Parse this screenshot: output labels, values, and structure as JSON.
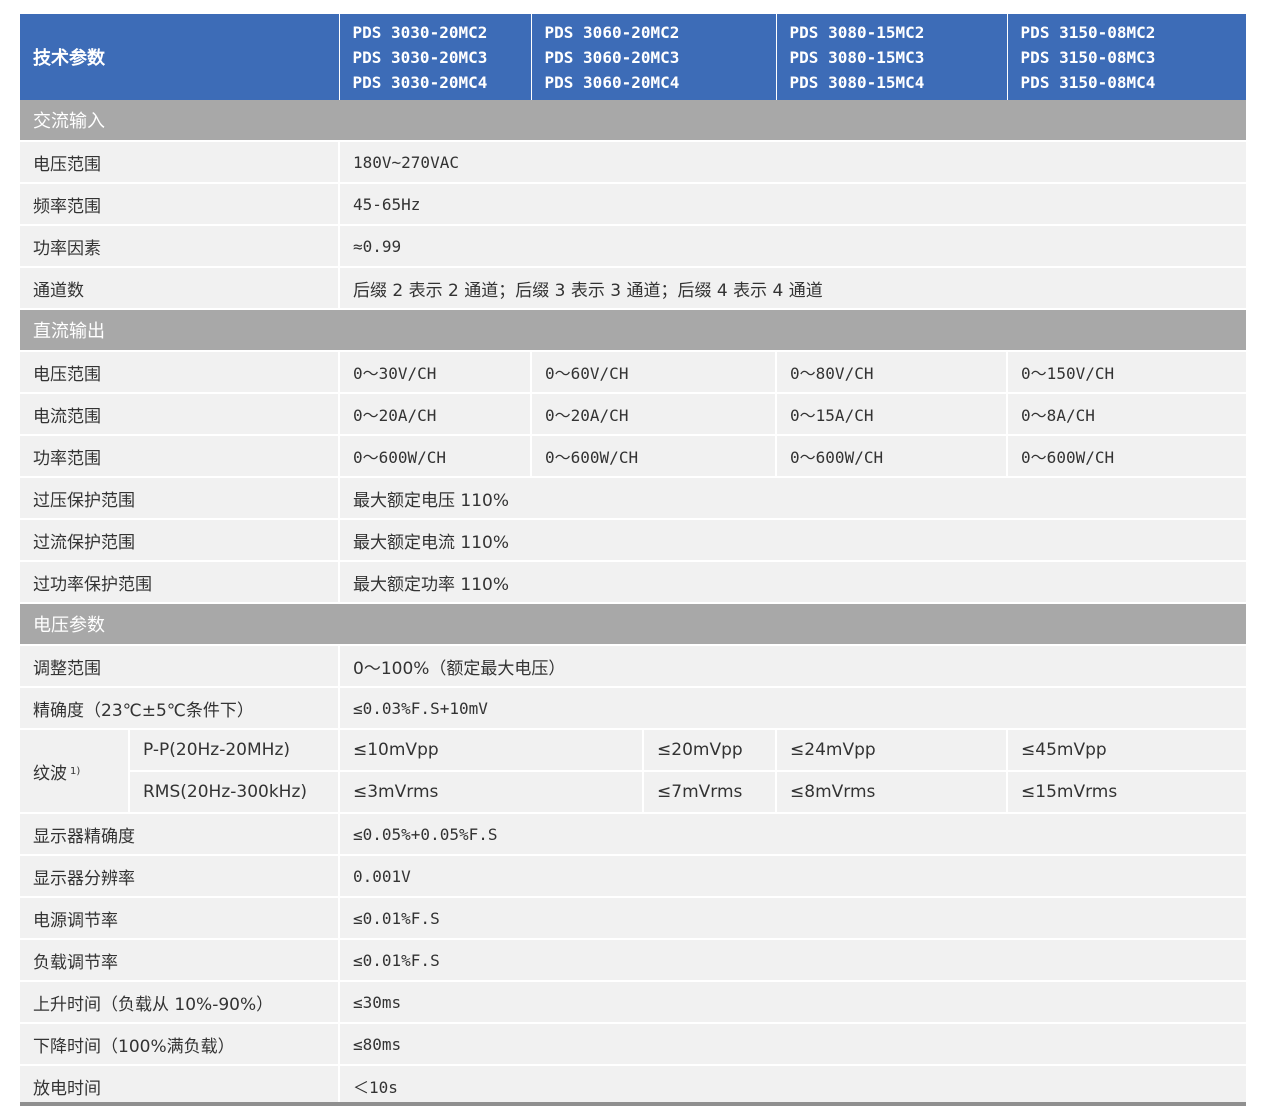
{
  "header": {
    "title": "技术参数",
    "model_groups": [
      [
        "PDS 3030-20MC2",
        "PDS 3030-20MC3",
        "PDS 3030-20MC4"
      ],
      [
        "PDS 3060-20MC2",
        "PDS 3060-20MC3",
        "PDS 3060-20MC4"
      ],
      [
        "PDS 3080-15MC2",
        "PDS 3080-15MC3",
        "PDS 3080-15MC4"
      ],
      [
        "PDS 3150-08MC2",
        "PDS 3150-08MC3",
        "PDS 3150-08MC4"
      ]
    ]
  },
  "ac_input": {
    "title": "交流输入",
    "rows": [
      {
        "label": "电压范围",
        "value": "180V~270VAC"
      },
      {
        "label": "频率范围",
        "value": "45-65Hz"
      },
      {
        "label": "功率因素",
        "value": "≈0.99"
      },
      {
        "label": "通道数",
        "value": "后缀 2 表示 2 通道；后缀 3 表示 3 通道；后缀 4 表示 4 通道"
      }
    ]
  },
  "dc_output": {
    "title": "直流输出",
    "multi_rows": [
      {
        "label": "电压范围",
        "values": [
          "0～30V/CH",
          "0～60V/CH",
          "0～80V/CH",
          "0～150V/CH"
        ]
      },
      {
        "label": "电流范围",
        "values": [
          "0～20A/CH",
          "0～20A/CH",
          "0～15A/CH",
          "0～8A/CH"
        ]
      },
      {
        "label": "功率范围",
        "values": [
          "0～600W/CH",
          "0～600W/CH",
          "0～600W/CH",
          "0～600W/CH"
        ]
      }
    ],
    "rows": [
      {
        "label": "过压保护范围",
        "value": "最大额定电压 110%"
      },
      {
        "label": "过流保护范围",
        "value": "最大额定电流 110%"
      },
      {
        "label": "过功率保护范围",
        "value": "最大额定功率 110%"
      }
    ]
  },
  "voltage_params": {
    "title": "电压参数",
    "rows_top": [
      {
        "label": "调整范围",
        "value": "0～100%（额定最大电压）"
      },
      {
        "label": "精确度（23℃±5℃条件下）",
        "value": "≤0.03%F.S+10mV"
      }
    ],
    "ripple": {
      "label": "纹波",
      "footnote": "1)",
      "rows": [
        {
          "sublabel": "P-P(20Hz-20MHz)",
          "values": [
            "≤10mVpp",
            "≤20mVpp",
            "≤24mVpp",
            "≤45mVpp"
          ]
        },
        {
          "sublabel": "RMS(20Hz-300kHz)",
          "values": [
            "≤3mVrms",
            "≤7mVrms",
            "≤8mVrms",
            "≤15mVrms"
          ]
        }
      ]
    },
    "rows_bottom": [
      {
        "label": "显示器精确度",
        "value": "≤0.05%+0.05%F.S"
      },
      {
        "label": "显示器分辨率",
        "value": "0.001V"
      },
      {
        "label": "电源调节率",
        "value": "≤0.01%F.S"
      },
      {
        "label": "负载调节率",
        "value": "≤0.01%F.S"
      },
      {
        "label": "上升时间（负载从 10%-90%）",
        "value": "≤30ms"
      },
      {
        "label": "下降时间（100%满负载）",
        "value": "≤80ms"
      },
      {
        "label": "放电时间",
        "value": "＜10s"
      }
    ]
  },
  "colors": {
    "header_bg": "#3d6cb7",
    "section_bg": "#a8a8a8",
    "row_bg": "#f1f1f1"
  }
}
